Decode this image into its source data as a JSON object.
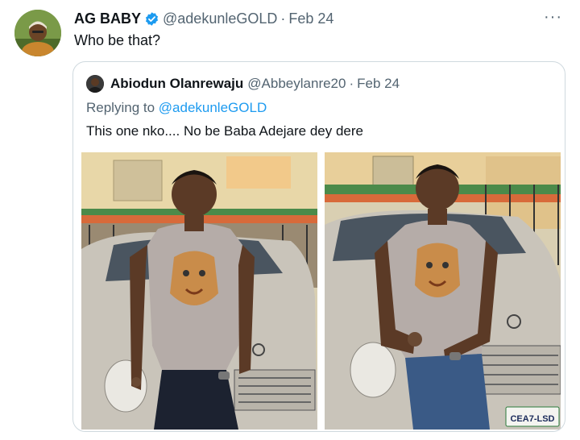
{
  "tweet": {
    "author_name": "AG BABY",
    "handle": "@adekunleGOLD",
    "separator": "·",
    "date": "Feb 24",
    "text": "Who be that?",
    "more_label": "···",
    "avatar_icon": "profile-avatar"
  },
  "quoted": {
    "author_name": "Abiodun Olanrewaju",
    "handle": "@Abbeylanre20",
    "separator": "·",
    "date": "Feb 24",
    "reply_prefix": "Replying to ",
    "reply_mention": "@adekunleGOLD",
    "text": "This one nko.... No be Baba Adejare dey dere",
    "plate_text": "CEA7-LSD"
  },
  "colors": {
    "verified_blue": "#1d9bf0",
    "secondary_text": "#536471",
    "border": "#cfd9de"
  }
}
